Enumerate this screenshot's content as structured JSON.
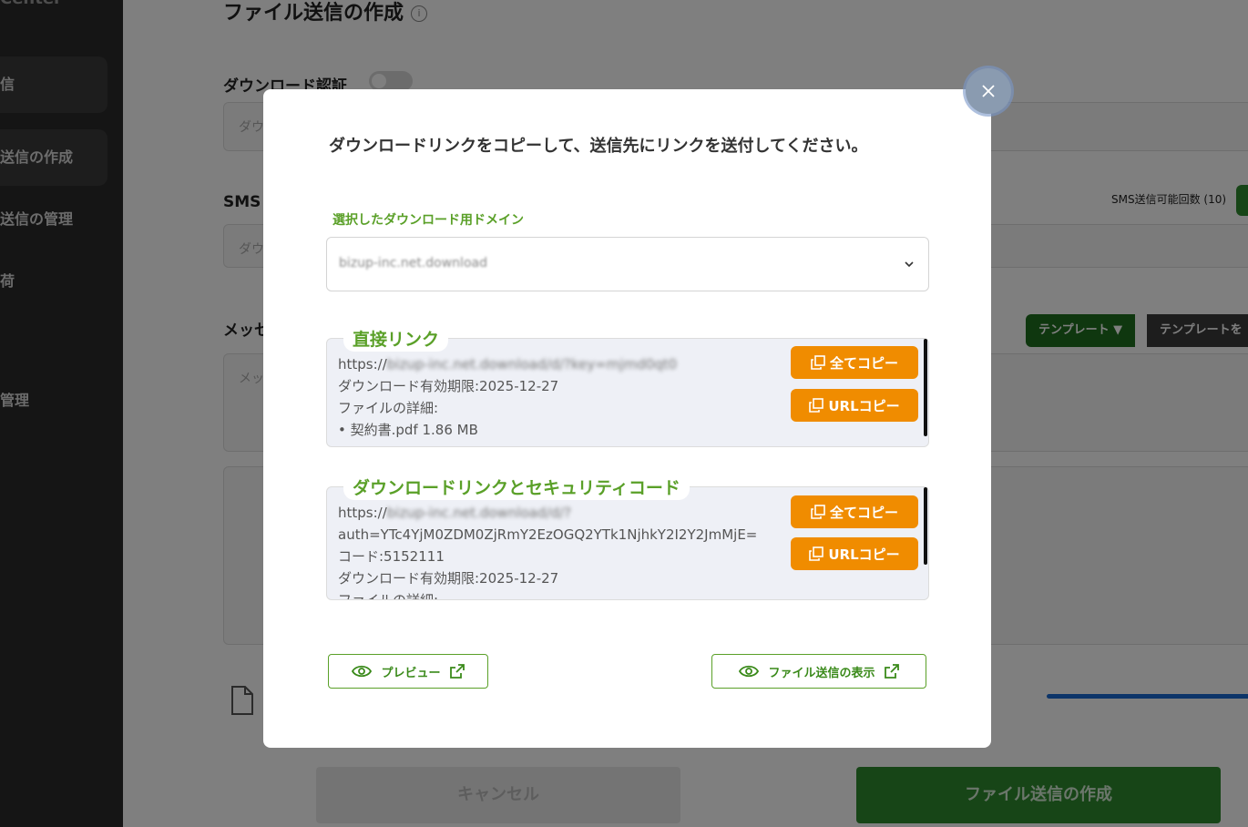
{
  "background": {
    "sidebar": {
      "brand": "Center",
      "items": [
        {
          "label": "信",
          "active": true
        },
        {
          "label": "送信の作成",
          "active": true
        },
        {
          "label": "送信の管理",
          "active": false
        },
        {
          "label": "荷",
          "active": false
        },
        {
          "label": "管理",
          "active": false
        }
      ]
    },
    "page_title": "ファイル送信の作成",
    "download_auth_label": "ダウンロード認証",
    "download_auth_placeholder": "ダウ",
    "sms_label": "SMS",
    "sms_placeholder": "ダウ",
    "sms_count": "SMS送信可能回数 (10)",
    "message_label": "メッセ",
    "message_placeholder": "メッ",
    "template_button": "テンプレート",
    "template_button_2": "テンプレートを",
    "cancel_button": "キャンセル",
    "create_button": "ファイル送信の作成"
  },
  "modal": {
    "heading": "ダウンロードリンクをコピーして、送信先にリンクを送付してください。",
    "domain_label": "選択したダウンロード用ドメイン",
    "domain_value": "bizup-inc.net.download",
    "direct_link": {
      "label": "直接リンク",
      "url_prefix": "https://",
      "url_rest": "bizup-inc.net.download/d/?key=mjmd0qt0",
      "expiry": "ダウンロード有効期限:2025-12-27",
      "details_label": "ファイルの詳細:",
      "file": "• 契約書.pdf  1.86 MB",
      "copy_all": "全てコピー",
      "copy_url": "URLコピー"
    },
    "secure_link": {
      "label": "ダウンロードリンクとセキュリティコード",
      "url_prefix": "https://",
      "url_rest": "bizup-inc.net.download/d/?",
      "auth": "auth=YTc4YjM0ZDM0ZjRmY2EzOGQ2YTk1NjhkY2I2Y2JmMjE=",
      "code": "コード:5152111",
      "expiry": "ダウンロード有効期限:2025-12-27",
      "details_label": "ファイルの詳細:",
      "copy_all": "全てコピー",
      "copy_url": "URLコピー"
    },
    "preview_button": "プレビュー",
    "view_transfer_button": "ファイル送信の表示"
  },
  "colors": {
    "accent_green": "#5aa028",
    "copy_orange": "#f08c00",
    "overlay": "rgba(0,0,0,0.5)"
  }
}
